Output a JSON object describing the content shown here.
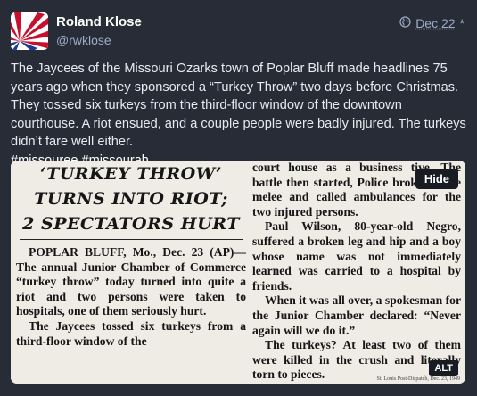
{
  "author": {
    "display_name": "Roland Klose",
    "handle": "@rwklose"
  },
  "meta": {
    "visibility_icon": "globe-icon",
    "timestamp": "Dec 22",
    "edited_marker": "*"
  },
  "content": {
    "text": "The Jaycees of the Missouri Ozarks town of Poplar Bluff made headlines 75 years ago when they sponsored a “Turkey Throw” two days before Christmas. They tossed six turkeys from the third-floor window of the downtown courthouse. A riot ensued, and a couple people were badly injured. The turkeys didn’t fare well either.",
    "hashtags": "#missouree #missourah"
  },
  "media": {
    "hide_label": "Hide",
    "alt_label": "ALT",
    "clipping": {
      "headline_1": "‘TURKEY THROW’",
      "headline_2": "TURNS INTO RIOT;",
      "headline_3": "2 SPECTATORS HURT",
      "left_p1": "POPLAR BLUFF, Mo., Dec. 23 (AP)—The annual Junior Chamber of Commerce “turkey throw” today turned into quite a riot and two persons were taken to hospitals, one of them seriously hurt.",
      "left_p2": "The Jaycees tossed six turkeys from a third-floor window of the",
      "right_p1": "court house as a business tive. The battle then started, Police broke up the melee and called ambulances for the two injured persons.",
      "right_p2": "Paul Wilson, 80-year-old Negro, suffered a broken leg and hip and a boy whose name was not immediately learned was carried to a hospital by friends.",
      "right_p3": "When it was all over, a spokesman for the Junior Chamber declared: “Never again will we do it.”",
      "right_p4": "The turkeys? At least two of them were killed in the crush and literally torn to pieces.",
      "credit": "St. Louis Post-Dispatch, Dec. 23, 1949"
    }
  }
}
